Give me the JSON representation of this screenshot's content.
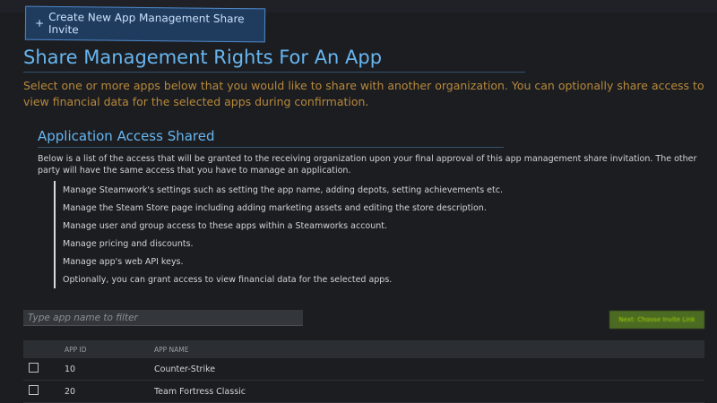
{
  "create_button": {
    "plus": "+",
    "label": "Create New App Management Share Invite"
  },
  "page_title": "Share Management Rights For An App",
  "intro_text": "Select one or more apps below that you would like to share with another organization. You can optionally share access to view financial data for the selected apps during confirmation.",
  "access_section": {
    "title": "Application Access Shared",
    "description": "Below is a list of the access that will be granted to the receiving organization upon your final approval of this app management share invitation. The other party will have the same access that you have to manage an application.",
    "items": [
      "Manage Steamwork's settings such as setting the app name, adding depots, setting achievements etc.",
      "Manage the Steam Store page including adding marketing assets and editing the store description.",
      "Manage user and group access to these apps within a Steamworks account.",
      "Manage pricing and discounts.",
      "Manage app's web API keys.",
      "Optionally, you can grant access to view financial data for the selected apps."
    ]
  },
  "filter": {
    "placeholder": "Type app name to filter",
    "value": ""
  },
  "next_button": {
    "label": "Next: Choose Invite Link"
  },
  "table": {
    "columns": [
      "",
      "APP ID",
      "APP NAME"
    ],
    "rows": [
      {
        "app_id": "10",
        "app_name": "Counter-Strike",
        "checked": false
      },
      {
        "app_id": "20",
        "app_name": "Team Fortress Classic",
        "checked": false
      }
    ]
  }
}
